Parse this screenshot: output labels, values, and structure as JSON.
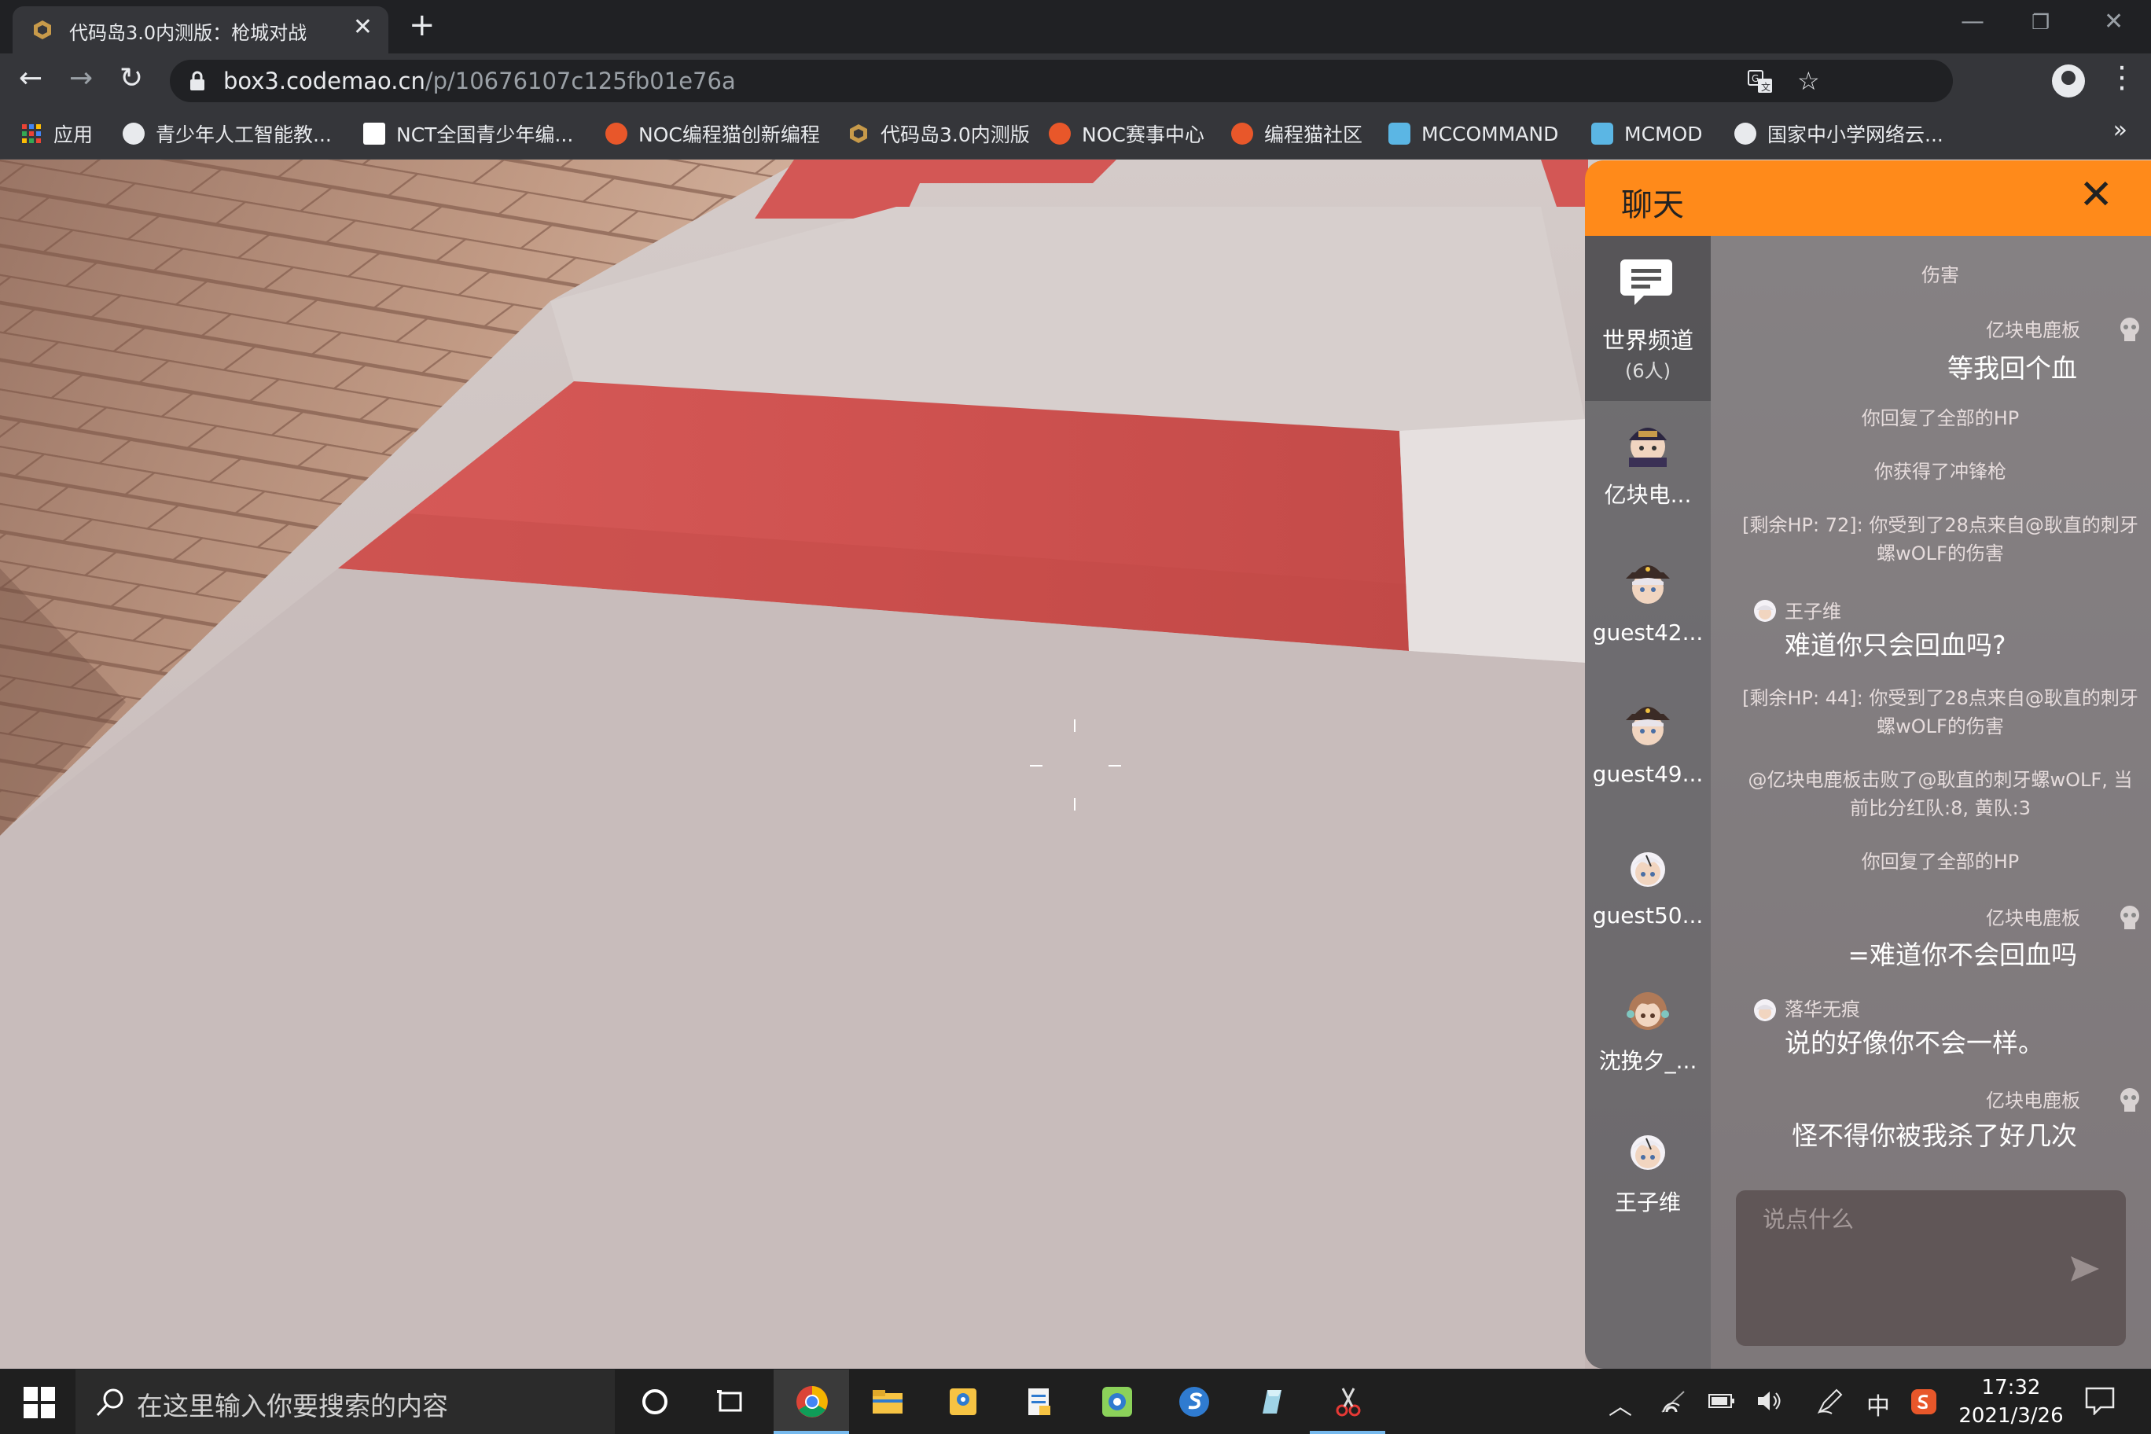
{
  "browser": {
    "tab_title": "代码岛3.0内测版：枪城对战",
    "tab_close": "✕",
    "new_tab": "+",
    "url_host": "box3.codemao.cn",
    "url_path": "/p/10676107c125fb01e76a",
    "bookmarks": [
      {
        "label": "应用",
        "icon": "apps-grid-icon",
        "color": "#ea4335"
      },
      {
        "label": "青少年人工智能教...",
        "icon": "globe-icon",
        "color": "#e8eaed"
      },
      {
        "label": "NCT全国青少年编...",
        "icon": "nct-icon",
        "color": "#ffffff"
      },
      {
        "label": "NOC编程猫创新编程",
        "icon": "codemao-icon",
        "color": "#e8572a"
      },
      {
        "label": "代码岛3.0内测版",
        "icon": "box3-icon",
        "color": "#c79a4a"
      },
      {
        "label": "NOC赛事中心",
        "icon": "codemao-icon",
        "color": "#e8572a"
      },
      {
        "label": "编程猫社区",
        "icon": "codemao-icon",
        "color": "#e8572a"
      },
      {
        "label": "MCCOMMAND",
        "icon": "mc-icon",
        "color": "#5bb6e4"
      },
      {
        "label": "MCMOD",
        "icon": "mc-icon",
        "color": "#5bb6e4"
      },
      {
        "label": "国家中小学网络云...",
        "icon": "globe-icon",
        "color": "#e8eaed"
      }
    ],
    "bookmarks_more": "»"
  },
  "chat": {
    "title": "聊天",
    "close": "✕",
    "channel": {
      "label": "世界频道",
      "count": "(6人)"
    },
    "members": [
      {
        "name": "亿块电...",
        "avatar": "pirate-avatar-icon"
      },
      {
        "name": "guest42...",
        "avatar": "hat-avatar-icon"
      },
      {
        "name": "guest49...",
        "avatar": "hat-avatar-icon"
      },
      {
        "name": "guest50...",
        "avatar": "white-hair-avatar-icon"
      },
      {
        "name": "沈挽夕_...",
        "avatar": "brown-hair-avatar-icon"
      },
      {
        "name": "王子维",
        "avatar": "white-hair-avatar-icon"
      }
    ],
    "system": {
      "s0": "伤害",
      "s1": "你回复了全部的HP",
      "s2": "你获得了冲锋枪",
      "s3a": "[剩余HP: 72]: 你受到了28点来自@耿直的刺牙",
      "s3b": "螺wOLF的伤害",
      "s4a": "[剩余HP: 44]: 你受到了28点来自@耿直的刺牙",
      "s4b": "螺wOLF的伤害",
      "s5a": "@亿块电鹿板击败了@耿直的刺牙螺wOLF, 当",
      "s5b": "前比分红队:8, 黄队:3",
      "s6": "你回复了全部的HP"
    },
    "messages": {
      "m1_sender": "亿块电鹿板",
      "m1_body": "等我回个血",
      "m2_sender": "王子维",
      "m2_body": "难道你只会回血吗?",
      "m3_sender": "亿块电鹿板",
      "m3_body": "=难道你不会回血吗",
      "m4_sender": "落华无痕",
      "m4_body": "说的好像你不会一样。",
      "m5_sender": "亿块电鹿板",
      "m5_body": "怪不得你被我杀了好几次"
    },
    "input_placeholder": "说点什么",
    "accent": "#ff8a1a"
  },
  "taskbar": {
    "search_placeholder": "在这里输入你要搜索的内容",
    "ime": "中",
    "time": "17:32",
    "date": "2021/3/26"
  }
}
